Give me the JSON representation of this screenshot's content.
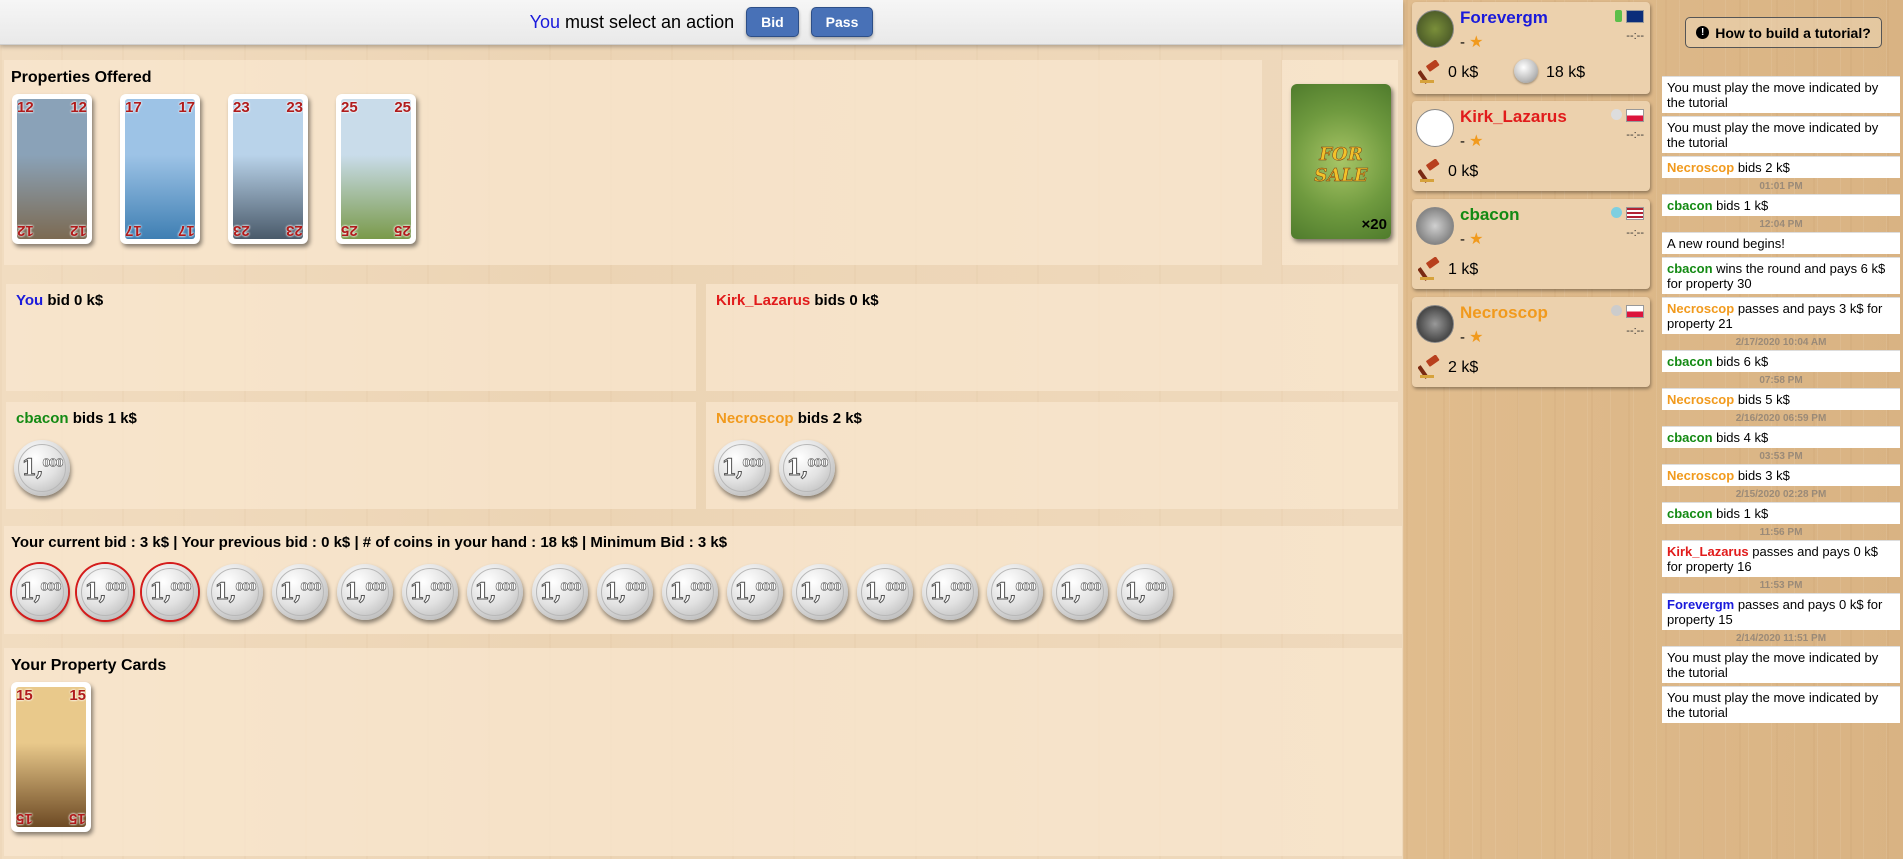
{
  "action_bar": {
    "you": "You",
    "message": "must select an action",
    "bid_label": "Bid",
    "pass_label": "Pass"
  },
  "offered": {
    "title": "Properties Offered",
    "cards": [
      12,
      17,
      23,
      25
    ],
    "deck_count": "×20",
    "deck_label": "FOR SALE"
  },
  "bids": {
    "you": {
      "name": "You",
      "text": "bid 0 k$",
      "coins": 0
    },
    "kirk": {
      "name": "Kirk_Lazarus",
      "text": "bids 0 k$",
      "coins": 0
    },
    "cbacon": {
      "name": "cbacon",
      "text": "bids 1 k$",
      "coins": 1
    },
    "necro": {
      "name": "Necroscop",
      "text": "bids 2 k$",
      "coins": 2
    }
  },
  "hand": {
    "status": "Your current bid : 3 k$ | Your previous bid : 0 k$ | # of coins in your hand : 18 k$ | Minimum Bid : 3 k$",
    "coin_count": 18,
    "selected": 3,
    "coin_value": "1",
    "coin_small": "000"
  },
  "property_cards": {
    "title": "Your Property Cards",
    "cards": [
      15
    ]
  },
  "players": [
    {
      "name": "Forevergm",
      "color": "#1a1adb",
      "score": "-",
      "time": "--:--",
      "bid": "0 k$",
      "coins": "18 k$",
      "flag": "au"
    },
    {
      "name": "Kirk_Lazarus",
      "color": "#e11b1b",
      "score": "-",
      "time": "--:--",
      "bid": "0 k$",
      "flag": "pl"
    },
    {
      "name": "cbacon",
      "color": "#138a13",
      "score": "-",
      "time": "--:--",
      "bid": "1 k$",
      "flag": "us"
    },
    {
      "name": "Necroscop",
      "color": "#f19a1d",
      "score": "-",
      "time": "--:--",
      "bid": "2 k$",
      "flag": "pl"
    }
  ],
  "tutorial_button": "How to build a tutorial?",
  "log": [
    {
      "type": "msg",
      "text": "You must play the move indicated by the tutorial"
    },
    {
      "type": "msg",
      "text": "You must play the move indicated by the tutorial"
    },
    {
      "type": "msg",
      "who": "Necroscop",
      "color": "#f19a1d",
      "text": "bids 2 k$"
    },
    {
      "type": "time",
      "text": "01:01 PM"
    },
    {
      "type": "msg",
      "who": "cbacon",
      "color": "#138a13",
      "text": "bids 1 k$"
    },
    {
      "type": "time",
      "text": "12:04 PM"
    },
    {
      "type": "msg",
      "text": "A new round begins!"
    },
    {
      "type": "msg",
      "who": "cbacon",
      "color": "#138a13",
      "text": "wins the round and pays 6 k$ for property 30"
    },
    {
      "type": "msg",
      "who": "Necroscop",
      "color": "#f19a1d",
      "text": "passes and pays 3 k$ for property 21"
    },
    {
      "type": "time",
      "text": "2/17/2020 10:04 AM"
    },
    {
      "type": "msg",
      "who": "cbacon",
      "color": "#138a13",
      "text": "bids 6 k$"
    },
    {
      "type": "time",
      "text": "07:58 PM"
    },
    {
      "type": "msg",
      "who": "Necroscop",
      "color": "#f19a1d",
      "text": "bids 5 k$"
    },
    {
      "type": "time",
      "text": "2/16/2020 06:59 PM"
    },
    {
      "type": "msg",
      "who": "cbacon",
      "color": "#138a13",
      "text": "bids 4 k$"
    },
    {
      "type": "time",
      "text": "03:53 PM"
    },
    {
      "type": "msg",
      "who": "Necroscop",
      "color": "#f19a1d",
      "text": "bids 3 k$"
    },
    {
      "type": "time",
      "text": "2/15/2020 02:28 PM"
    },
    {
      "type": "msg",
      "who": "cbacon",
      "color": "#138a13",
      "text": "bids 1 k$"
    },
    {
      "type": "time",
      "text": "11:56 PM"
    },
    {
      "type": "msg",
      "who": "Kirk_Lazarus",
      "color": "#e11b1b",
      "text": "passes and pays 0 k$ for property 16"
    },
    {
      "type": "time",
      "text": "11:53 PM"
    },
    {
      "type": "msg",
      "who": "Forevergm",
      "color": "#1a1adb",
      "text": "passes and pays 0 k$ for property 15"
    },
    {
      "type": "time",
      "text": "2/14/2020 11:51 PM"
    },
    {
      "type": "msg",
      "text": "You must play the move indicated by the tutorial"
    },
    {
      "type": "msg",
      "text": "You must play the move indicated by the tutorial"
    }
  ]
}
